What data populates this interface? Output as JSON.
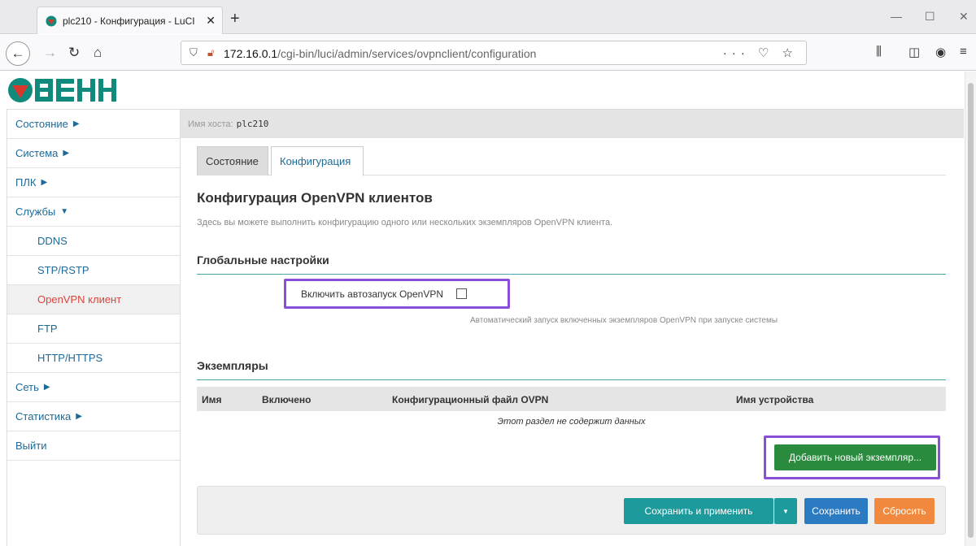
{
  "browser": {
    "tab_title": "plc210 - Конфигурация - LuCI",
    "new_tab": "+",
    "url_host": "172.16.0.1",
    "url_path": "/cgi-bin/luci/admin/services/ovpnclient/configuration",
    "url_actions": "··· ♡ ☆"
  },
  "logo": {
    "text": "ОВЕН",
    "color": "#0f8a7c",
    "accent": "#d8372c"
  },
  "hostbar": {
    "label": "Имя хоста:",
    "host": "plc210"
  },
  "sidebar": {
    "items": [
      {
        "label": "Состояние",
        "caret": "▶"
      },
      {
        "label": "Система",
        "caret": "▶"
      },
      {
        "label": "ПЛК",
        "caret": "▶"
      },
      {
        "label": "Службы",
        "caret": "▼"
      },
      {
        "label": "DDNS"
      },
      {
        "label": "STP/RSTP"
      },
      {
        "label": "OpenVPN клиент"
      },
      {
        "label": "FTP"
      },
      {
        "label": "HTTP/HTTPS"
      },
      {
        "label": "Сеть",
        "caret": "▶"
      },
      {
        "label": "Статистика",
        "caret": "▶"
      },
      {
        "label": "Выйти"
      }
    ]
  },
  "tabs": {
    "status": "Состояние",
    "config": "Конфигурация"
  },
  "main": {
    "title": "Конфигурация OpenVPN клиентов",
    "description": "Здесь вы можете выполнить конфигурацию одного или нескольких экземпляров OpenVPN клиента.",
    "global_title": "Глобальные настройки",
    "autostart_label": "Включить автозапуск OpenVPN",
    "autostart_hint": "Автоматический запуск включенных экземпляров OpenVPN при запуске системы",
    "instances_title": "Экземпляры",
    "columns": [
      "Имя",
      "Включено",
      "Конфигурационный файл OVPN",
      "Имя устройства"
    ],
    "empty_message": "Этот раздел не содержит данных",
    "add_button": "Добавить новый экземпляр..."
  },
  "footer": {
    "apply": "Сохранить и применить",
    "apply_dropdown": "▼",
    "save": "Сохранить",
    "reset": "Сбросить"
  }
}
